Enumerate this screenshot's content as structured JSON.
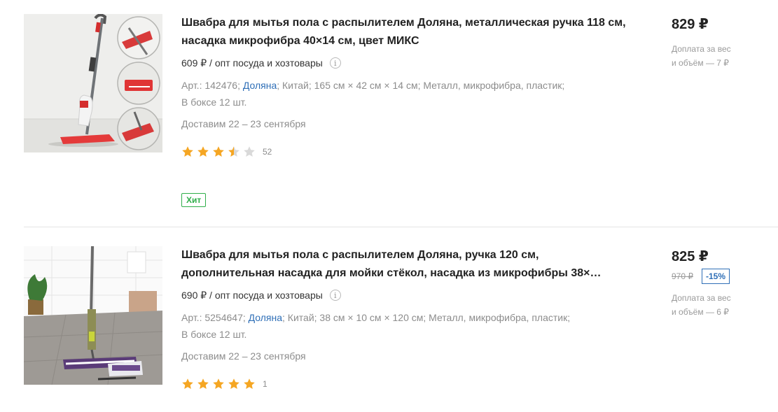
{
  "products": [
    {
      "title": "Швабра для мытья пола с распылителем Доляна, металлическая ручка 118 см, насадка микрофибра 40×14 см, цвет МИКС",
      "wholesale": "609 ₽ / опт посуда и хозтовары",
      "specs_prefix": "Арт.: 142476;",
      "brand": "Доляна",
      "specs_suffix": "; Китай; 165 см × 42 см × 14 см; Металл, микрофибра, пластик;",
      "specs_line2": "В боксе 12 шт.",
      "delivery": "Доставим 22 – 23 сентября",
      "rating": 3.5,
      "reviews": "52",
      "badge": "Хит",
      "price": "829 ₽",
      "extra_line1": "Доплата за вес",
      "extra_line2": "и объём — 7 ₽"
    },
    {
      "title": "Швабра для мытья пола с распылителем Доляна, ручка 120 см, дополнительная насадка для мойки стёкол, насадка из микрофибры 38×…",
      "wholesale": "690 ₽ / опт посуда и хозтовары",
      "specs_prefix": "Арт.: 5254647;",
      "brand": "Доляна",
      "specs_suffix": "; Китай; 38 см × 10 см × 120 см; Металл, микрофибра, пластик;",
      "specs_line2": "В боксе 12 шт.",
      "delivery": "Доставим 22 – 23 сентября",
      "rating": 5,
      "reviews": "1",
      "price": "825 ₽",
      "old_price": "970 ₽",
      "discount": "-15%",
      "extra_line1": "Доплата за вес",
      "extra_line2": "и объём — 6 ₽"
    }
  ],
  "icons": {
    "info": "info-icon",
    "star": "star-icon"
  },
  "colors": {
    "star": "#f5a623",
    "star_empty": "#d9d9d9",
    "link": "#2f6fb7",
    "hit": "#2fae4a",
    "discount": "#2f6fb7"
  }
}
